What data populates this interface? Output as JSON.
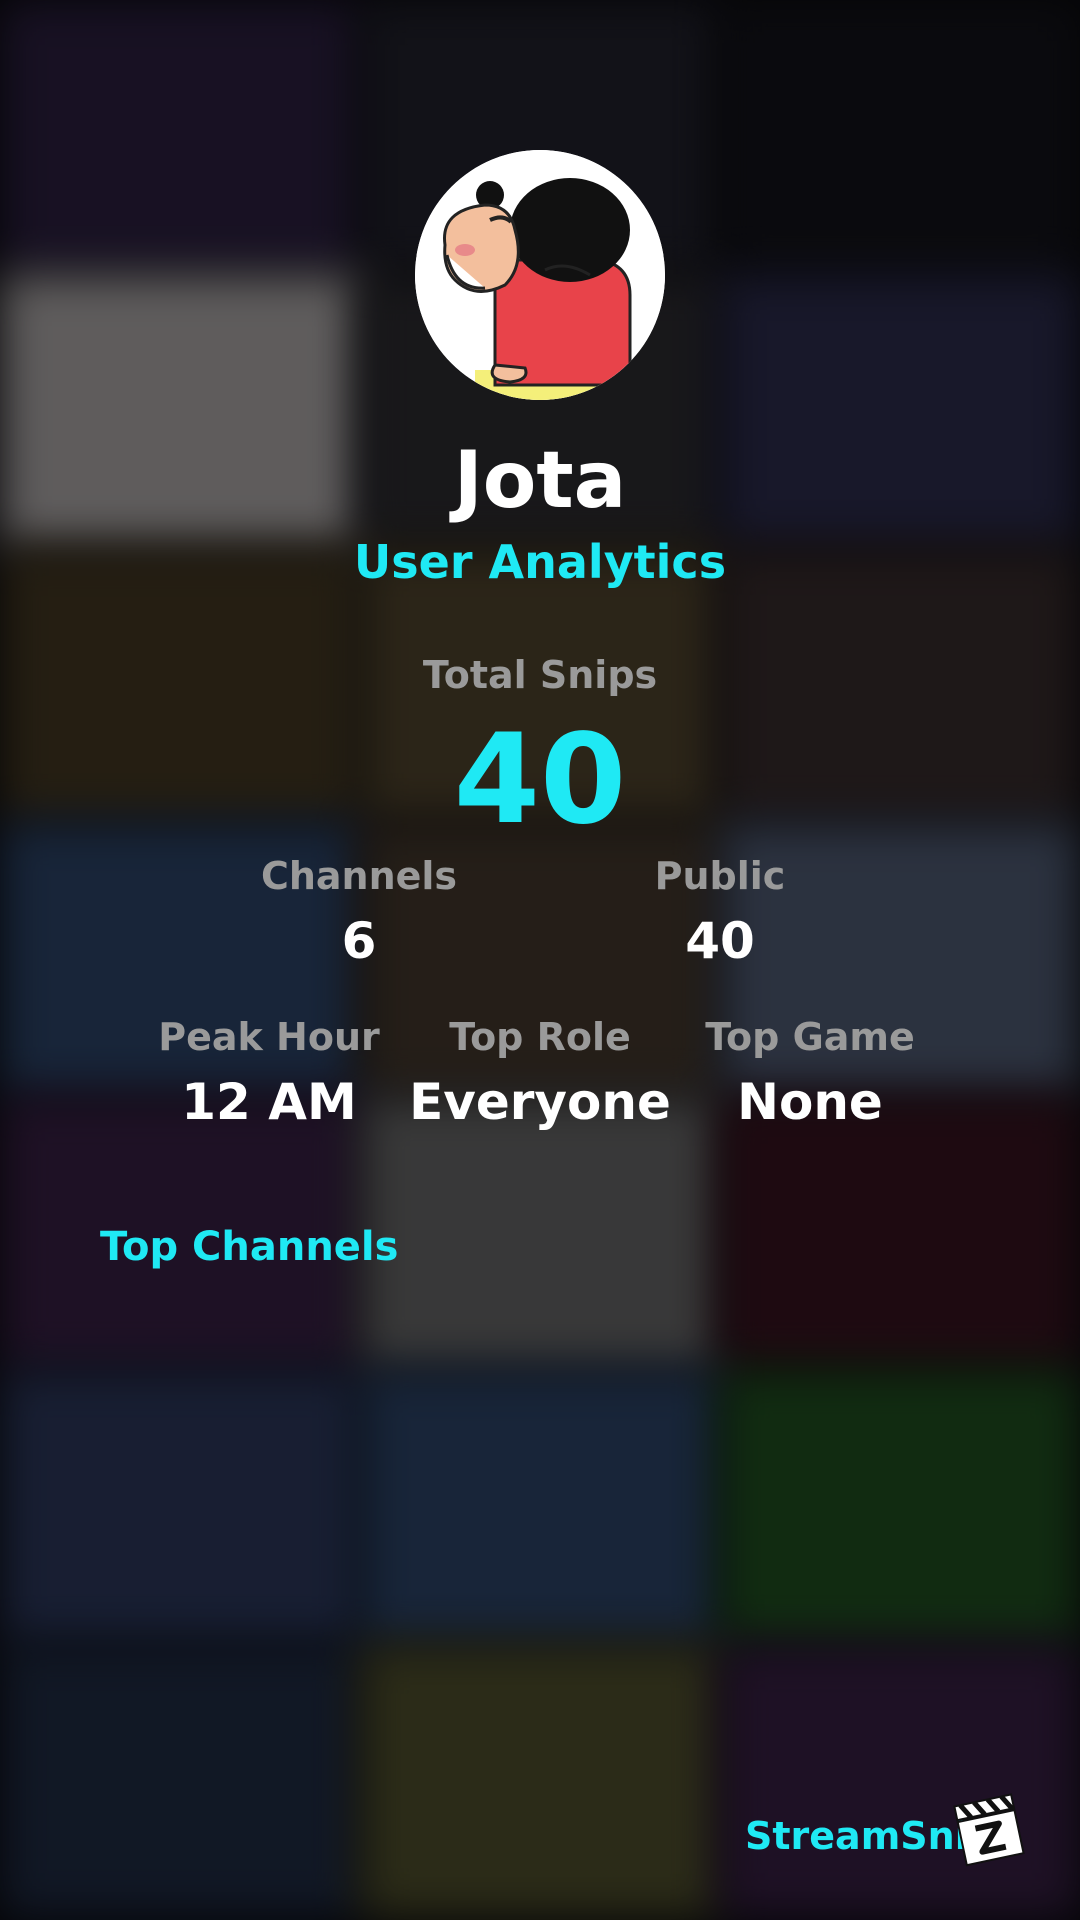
{
  "profile": {
    "username": "Jota",
    "subtitle": "User Analytics",
    "avatar_icon": "cartoon-avatar-icon"
  },
  "stats": {
    "total_snips_label": "Total Snips",
    "total_snips_value": "40",
    "channels_label": "Channels",
    "channels_value": "6",
    "public_label": "Public",
    "public_value": "40",
    "peak_hour_label": "Peak Hour",
    "peak_hour_value": "12 AM",
    "top_role_label": "Top Role",
    "top_role_value": "Everyone",
    "top_game_label": "Top Game",
    "top_game_value": "None"
  },
  "sections": {
    "top_channels_title": "Top Channels"
  },
  "footer": {
    "brand_name": "StreamSnip",
    "brand_icon": "clapperboard-logo-icon"
  },
  "colors": {
    "accent": "#1fe9f4",
    "label": "#9a9a9a",
    "value": "#ffffff",
    "background": "#0b0b10"
  }
}
